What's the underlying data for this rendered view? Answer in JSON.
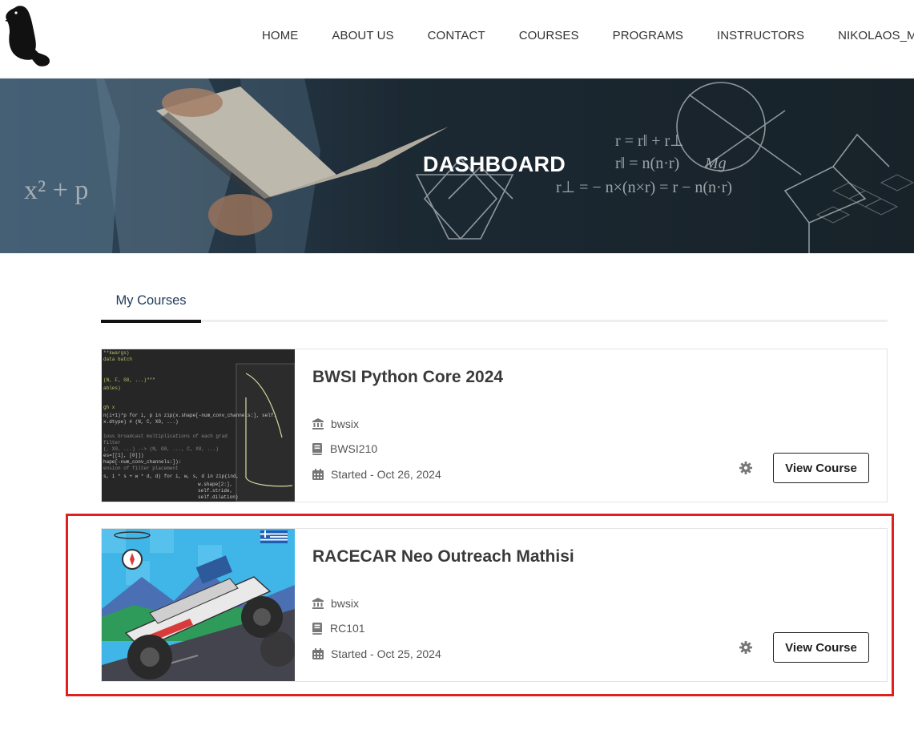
{
  "header": {
    "nav": [
      {
        "label": "HOME"
      },
      {
        "label": "ABOUT US"
      },
      {
        "label": "CONTACT"
      },
      {
        "label": "COURSES"
      },
      {
        "label": "PROGRAMS"
      },
      {
        "label": "INSTRUCTORS"
      },
      {
        "label": "NIKOLAOS_MAVRAKIS"
      }
    ]
  },
  "hero": {
    "title": "DASHBOARD"
  },
  "tabs": {
    "my_courses": "My Courses"
  },
  "courses": [
    {
      "title": "BWSI Python Core 2024",
      "institution": "bwsix",
      "code": "BWSI210",
      "started": "Started - Oct 26, 2024",
      "button": "View Course"
    },
    {
      "title": "RACECAR Neo Outreach Mathisi",
      "institution": "bwsix",
      "code": "RC101",
      "started": "Started - Oct 25, 2024",
      "button": "View Course"
    }
  ],
  "colors": {
    "accent": "#1e3a5a",
    "highlight": "#e02020",
    "tab_underline": "#111111"
  }
}
